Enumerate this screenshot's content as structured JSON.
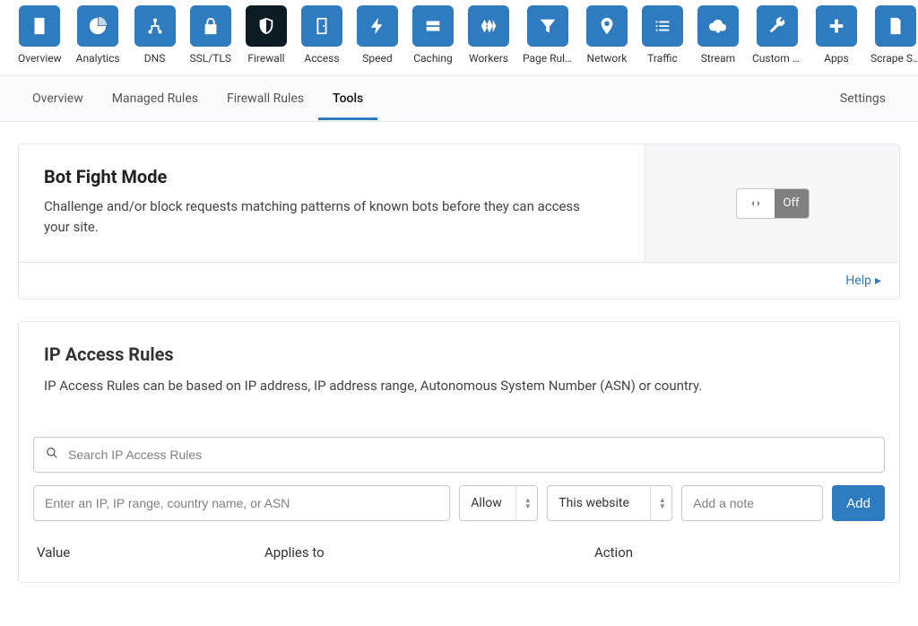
{
  "topNav": [
    {
      "label": "Overview",
      "icon": "clipboard"
    },
    {
      "label": "Analytics",
      "icon": "pie"
    },
    {
      "label": "DNS",
      "icon": "network"
    },
    {
      "label": "SSL/TLS",
      "icon": "lock"
    },
    {
      "label": "Firewall",
      "icon": "shield",
      "active": true
    },
    {
      "label": "Access",
      "icon": "door"
    },
    {
      "label": "Speed",
      "icon": "bolt"
    },
    {
      "label": "Caching",
      "icon": "drive"
    },
    {
      "label": "Workers",
      "icon": "workers"
    },
    {
      "label": "Page Rules",
      "icon": "funnel"
    },
    {
      "label": "Network",
      "icon": "pin"
    },
    {
      "label": "Traffic",
      "icon": "list"
    },
    {
      "label": "Stream",
      "icon": "cloud"
    },
    {
      "label": "Custom P…",
      "icon": "wrench"
    },
    {
      "label": "Apps",
      "icon": "plus"
    },
    {
      "label": "Scrape Shi…",
      "icon": "doc"
    }
  ],
  "subNav": [
    "Overview",
    "Managed Rules",
    "Firewall Rules",
    "Tools"
  ],
  "subNavActive": "Tools",
  "subNavRight": "Settings",
  "botCard": {
    "title": "Bot Fight Mode",
    "desc": "Challenge and/or block requests matching patterns of known bots before they can access your site.",
    "toggleOff": "Off",
    "help": "Help"
  },
  "ipCard": {
    "title": "IP Access Rules",
    "desc": "IP Access Rules can be based on IP address, IP address range, Autonomous System Number (ASN) or country.",
    "searchPlaceholder": "Search IP Access Rules",
    "ipPlaceholder": "Enter an IP, IP range, country name, or ASN",
    "actionSelect": "Allow",
    "scopeSelect": "This website",
    "notePlaceholder": "Add a note",
    "addButton": "Add",
    "columns": {
      "value": "Value",
      "applies": "Applies to",
      "action": "Action"
    }
  }
}
